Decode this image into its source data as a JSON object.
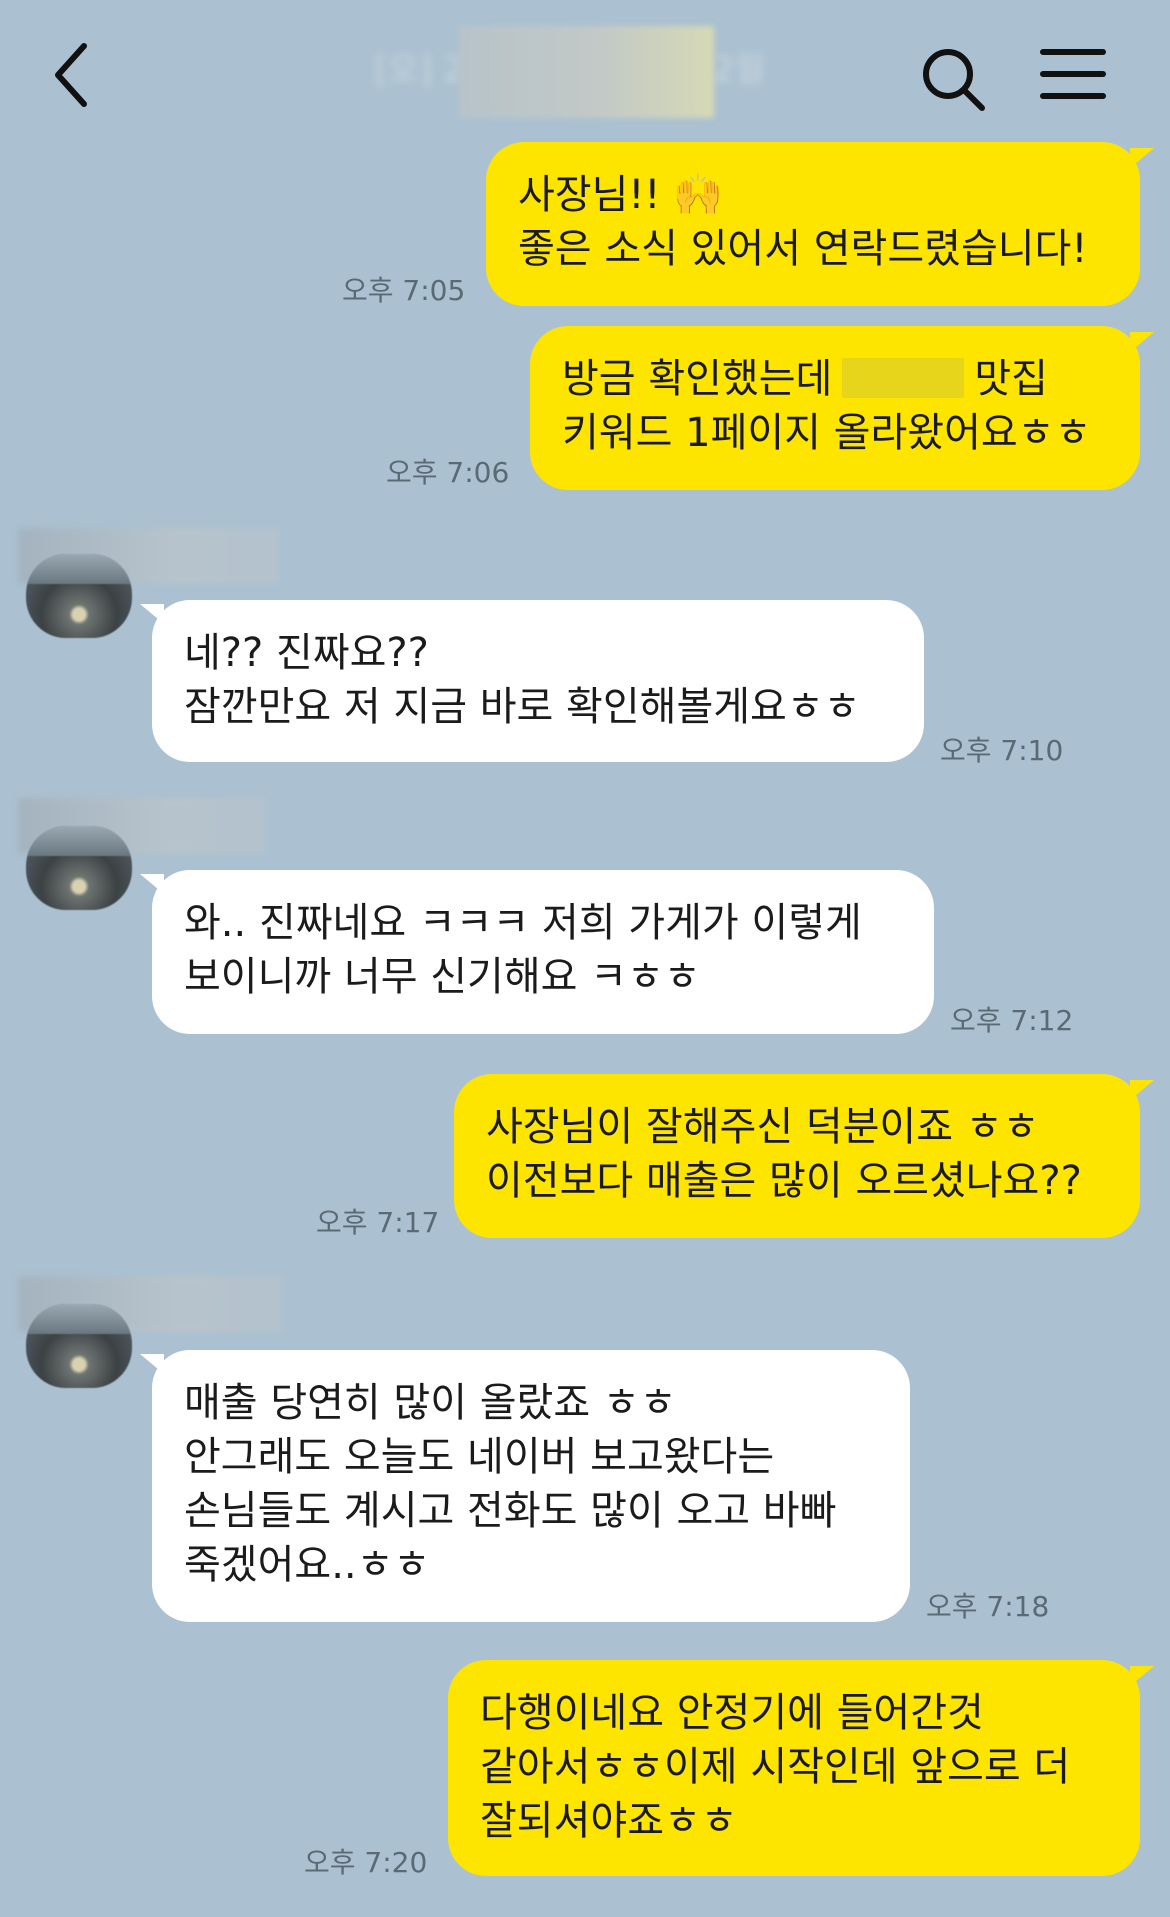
{
  "header": {
    "title": "[오] 202█ ██████ 2월"
  },
  "messages": [
    {
      "side": "me",
      "lines": [
        "사장님!! 🙌",
        "좋은 소식 있어서 연락드렸습니다!"
      ],
      "time": "오후 7:05"
    },
    {
      "side": "me",
      "lines": [
        "방금 확인했는데",
        "맛집",
        "키워드 1페이지 올라왔어요ㅎㅎ"
      ],
      "time": "오후 7:06"
    },
    {
      "side": "other",
      "lines": [
        "네?? 진짜요??",
        "잠깐만요 저 지금 바로 확인해볼게요ㅎㅎ"
      ],
      "time": "오후 7:10"
    },
    {
      "side": "other",
      "lines": [
        "와.. 진짜네요 ㅋㅋㅋ 저희 가게가 이렇게",
        "보이니까 너무 신기해요 ㅋㅎㅎ"
      ],
      "time": "오후 7:12"
    },
    {
      "side": "me",
      "lines": [
        "사장님이 잘해주신 덕분이죠 ㅎㅎ",
        "이전보다 매출은 많이 오르셨나요??"
      ],
      "time": "오후 7:17"
    },
    {
      "side": "other",
      "lines": [
        "매출 당연히 많이 올랐죠 ㅎㅎ",
        "안그래도 오늘도 네이버 보고왔다는",
        "손님들도 계시고 전화도 많이 오고 바빠",
        "죽겠어요..ㅎㅎ"
      ],
      "time": "오후 7:18"
    },
    {
      "side": "me",
      "lines": [
        "다행이네요 안정기에 들어간것",
        "같아서ㅎㅎ이제 시작인데 앞으로 더",
        "잘되셔야죠ㅎㅎ"
      ],
      "time": "오후 7:20"
    }
  ]
}
